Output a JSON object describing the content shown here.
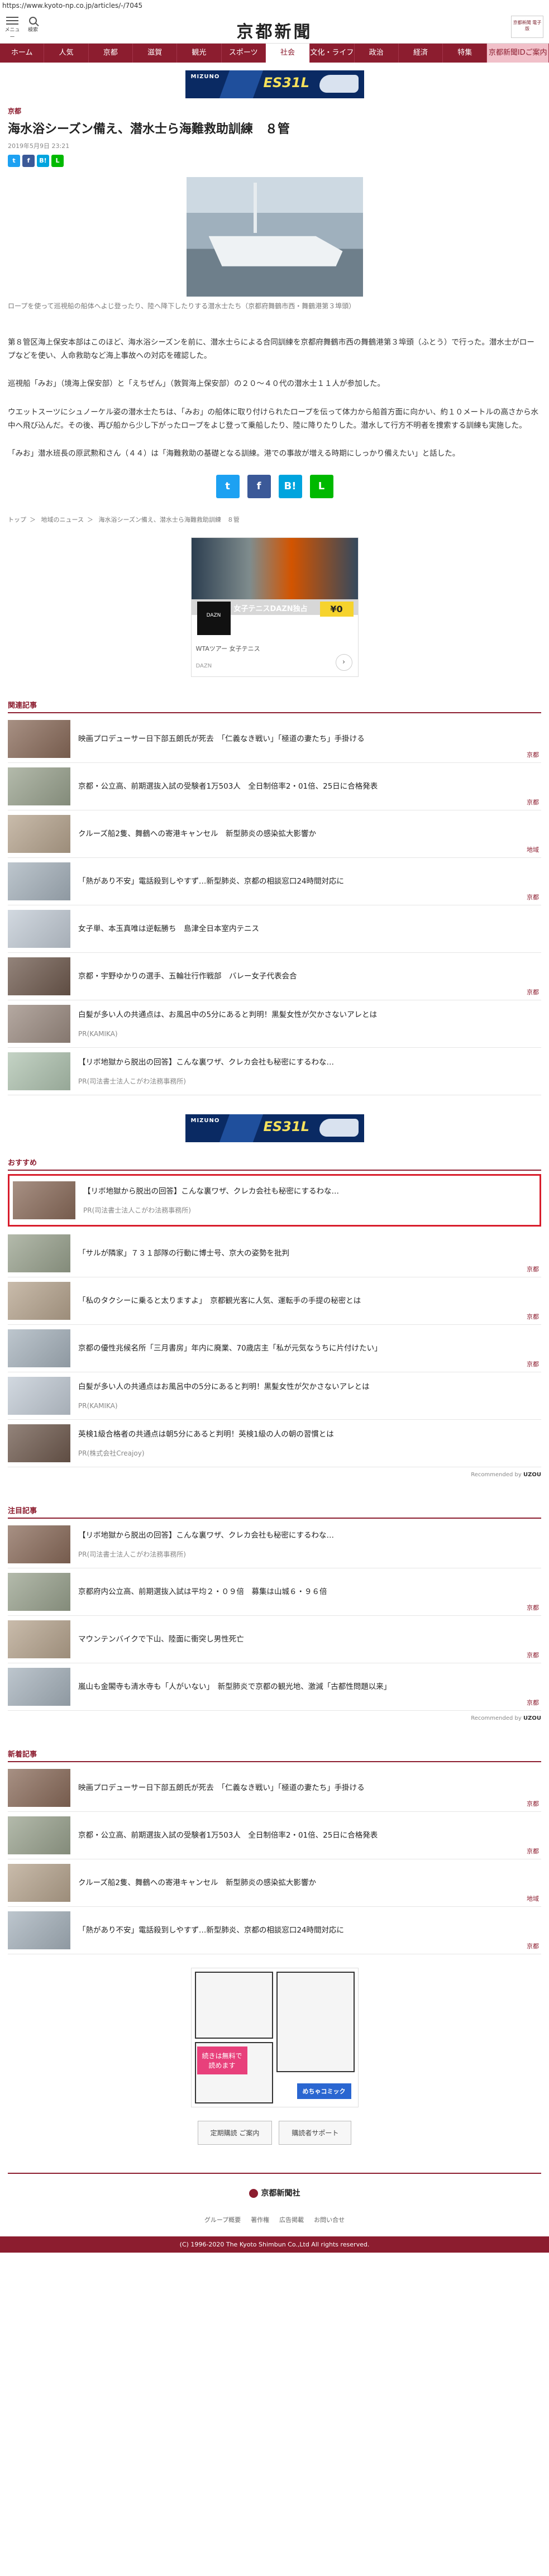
{
  "url": "https://www.kyoto-np.co.jp/articles/-/7045",
  "header": {
    "menu_label": "メニュー",
    "search_label": "検索",
    "logo": "京都新聞",
    "badge": "京都新聞 電子版"
  },
  "nav": [
    "ホーム",
    "人気",
    "京都",
    "滋賀",
    "観光",
    "スポーツ",
    "社会",
    "文化・ライフ",
    "政治",
    "経済",
    "特集",
    "京都新聞IDご案内"
  ],
  "nav_active": "社会",
  "ads": {
    "banner_brand": "MIZUNO",
    "banner_product": "ES31L"
  },
  "article": {
    "section": "京都",
    "title": "海水浴シーズン備え、潜水士ら海難救助訓練　８管",
    "date": "2019年5月9日 23:21",
    "share": [
      "t",
      "f",
      "B!",
      "L"
    ],
    "caption": "ロープを使って巡視船の船体へよじ登ったり、陸へ降下したりする潜水士たち（京都府舞鶴市西・舞鶴港第３埠頭）",
    "paragraphs": [
      "第８管区海上保安本部はこのほど、海水浴シーズンを前に、潜水士らによる合同訓練を京都府舞鶴市西の舞鶴港第３埠頭（ふとう）で行った。潜水士がロープなどを使い、人命救助など海上事故への対応を確認した。",
      "巡視船「みお」（境海上保安部）と「えちぜん」（敦賀海上保安部）の２０～４０代の潜水士１１人が参加した。",
      "ウエットスーツにシュノーケル姿の潜水士たちは、「みお」の船体に取り付けられたロープを伝って体力から船首方面に向かい、約１０メートルの高さから水中へ飛び込んだ。その後、再び船から少し下がったロープをよじ登って乗船したり、陸に降りたりした。潜水して行方不明者を捜索する訓練も実施した。",
      "「みお」潜水班長の原武勲和さん（４４）は「海難救助の基礎となる訓練。港での事故が増える時期にしっかり備えたい」と話した。"
    ]
  },
  "breadcrumb": [
    "トップ",
    "地域のニュース",
    "海水浴シーズン備え、潜水士ら海難救助訓練　８管"
  ],
  "ad_rect": {
    "logo": "DAZN",
    "title": "女子テニスDAZN独占",
    "price": "¥0",
    "desc": "WTAツアー 女子テニス",
    "sub": "DAZN"
  },
  "related": {
    "title": "関連記事",
    "items": [
      {
        "text": "映画プロデューサー日下部五朗氏が死去　「仁義なき戦い」「極道の妻たち」手掛ける",
        "cat": "京都"
      },
      {
        "text": "京都・公立高、前期選抜入試の受験者1万503人　全日制倍率2・01倍、25日に合格発表",
        "cat": "京都"
      },
      {
        "text": "クルーズ船2隻、舞鶴への寄港キャンセル　新型肺炎の感染拡大影響か",
        "cat": "地域"
      },
      {
        "text": "「熱があり不安」電話殺到しやすず…新型肺炎、京都の相談窓口24時間対応に",
        "cat": "京都"
      },
      {
        "text": "女子単、本玉真唯は逆転勝ち　島津全日本室内テニス",
        "cat": ""
      },
      {
        "text": "京都・宇野ゆかりの選手、五輪壮行作戦部　バレー女子代表会合",
        "cat": "京都"
      },
      {
        "text": "白髪が多い人の共通点は、お風呂中の5分にあると判明！黒髪女性が欠かさないアレとは",
        "pr": "PR(KAMIKA)"
      },
      {
        "text": "【リボ地獄から脱出の回答】こんな裏ワザ、クレカ会社も秘密にするわな…",
        "pr": "PR(司法書士法人こがわ法務事務所)"
      }
    ]
  },
  "recommend": {
    "title": "おすすめ",
    "items": [
      {
        "text": "【リボ地獄から脱出の回答】こんな裏ワザ、クレカ会社も秘密にするわな…",
        "pr": "PR(司法書士法人こがわ法務事務所)",
        "highlight": true
      },
      {
        "text": "「サルが隣家」７３１部隊の行動に博士号、京大の姿勢を批判",
        "cat": "京都"
      },
      {
        "text": "「私のタクシーに乗ると太りますよ」　京都観光客に人気、運転手の手提の秘密とは",
        "cat": "京都"
      },
      {
        "text": "京都の優性兆候名所「三月書房」年内に廃業、70歳店主「私が元気なうちに片付けたい」",
        "cat": "京都"
      },
      {
        "text": "白髪が多い人の共通点はお風呂中の5分にあると判明！黒髪女性が欠かさないアレとは",
        "pr": "PR(KAMIKA)"
      },
      {
        "text": "英検1級合格者の共通点は朝5分にあると判明！英検1級の人の朝の習慣とは",
        "pr": "PR(株式会社Creajoy)"
      }
    ],
    "by": "Recommended by"
  },
  "attention": {
    "title": "注目記事",
    "items": [
      {
        "text": "【リボ地獄から脱出の回答】こんな裏ワザ、クレカ会社も秘密にするわな…",
        "pr": "PR(司法書士法人こがわ法務事務所)"
      },
      {
        "text": "京都府内公立高、前期選抜入試は平均２・０９倍　募集は山城６・９６倍",
        "cat": "京都"
      },
      {
        "text": "マウンテンバイクで下山、陸面に衝突し男性死亡",
        "cat": "京都"
      },
      {
        "text": "嵐山も金閣寺も清水寺も「人がいない」　新型肺炎で京都の観光地、激減「古都性問題以来」",
        "cat": "京都"
      }
    ],
    "by": "Recommended by"
  },
  "latest": {
    "title": "新着記事",
    "items": [
      {
        "text": "映画プロデューサー日下部五朗氏が死去　「仁義なき戦い」「極道の妻たち」手掛ける",
        "cat": "京都"
      },
      {
        "text": "京都・公立高、前期選抜入試の受験者1万503人　全日制倍率2・01倍、25日に合格発表",
        "cat": "京都"
      },
      {
        "text": "クルーズ船2隻、舞鶴への寄港キャンセル　新型肺炎の感染拡大影響か",
        "cat": "地域"
      },
      {
        "text": "「熱があり不安」電話殺到しやすず…新型肺炎、京都の相談窓口24時間対応に",
        "cat": "京都"
      }
    ]
  },
  "manga_ad": {
    "badge": "続きは無料で読めます",
    "brand": "めちゃコミック"
  },
  "footer": {
    "buttons": [
      "定期購読 ご案内",
      "購読者サポート"
    ],
    "logo": "京都新聞社",
    "links": [
      "グループ概要",
      "著作権",
      "広告掲載",
      "お問い合せ"
    ],
    "copyright": "(C) 1996-2020 The Kyoto Shimbun Co.,Ltd All rights reserved."
  },
  "colors": {
    "brand": "#8c1d2f",
    "highlight_border": "#d81c2b"
  }
}
